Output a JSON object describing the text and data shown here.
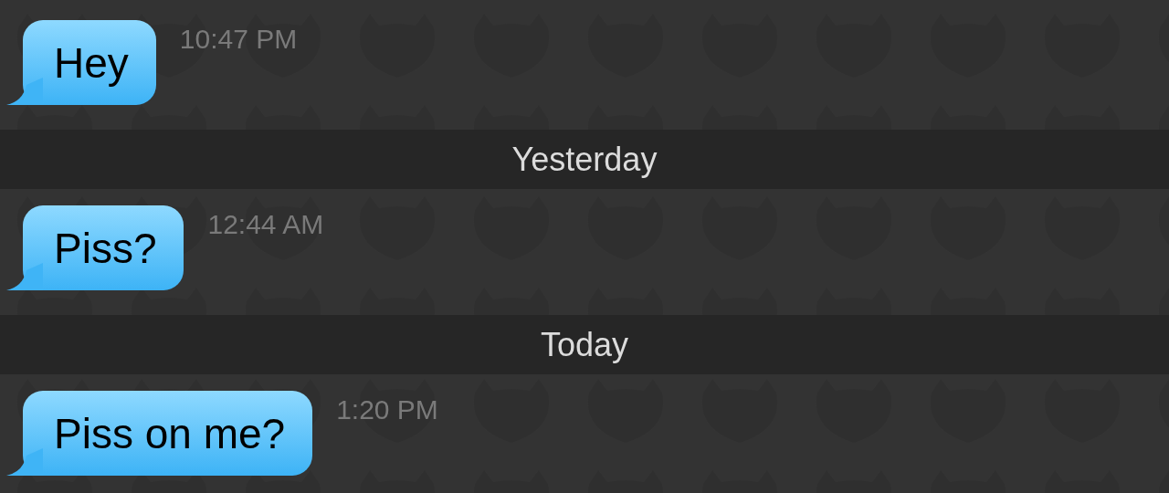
{
  "messages": [
    {
      "kind": "message",
      "text": "Hey",
      "time": "10:47 PM"
    },
    {
      "kind": "date",
      "label": "Yesterday"
    },
    {
      "kind": "message",
      "text": "Piss?",
      "time": "12:44 AM"
    },
    {
      "kind": "date",
      "label": "Today"
    },
    {
      "kind": "message",
      "text": "Piss on me?",
      "time": "1:20 PM"
    }
  ]
}
